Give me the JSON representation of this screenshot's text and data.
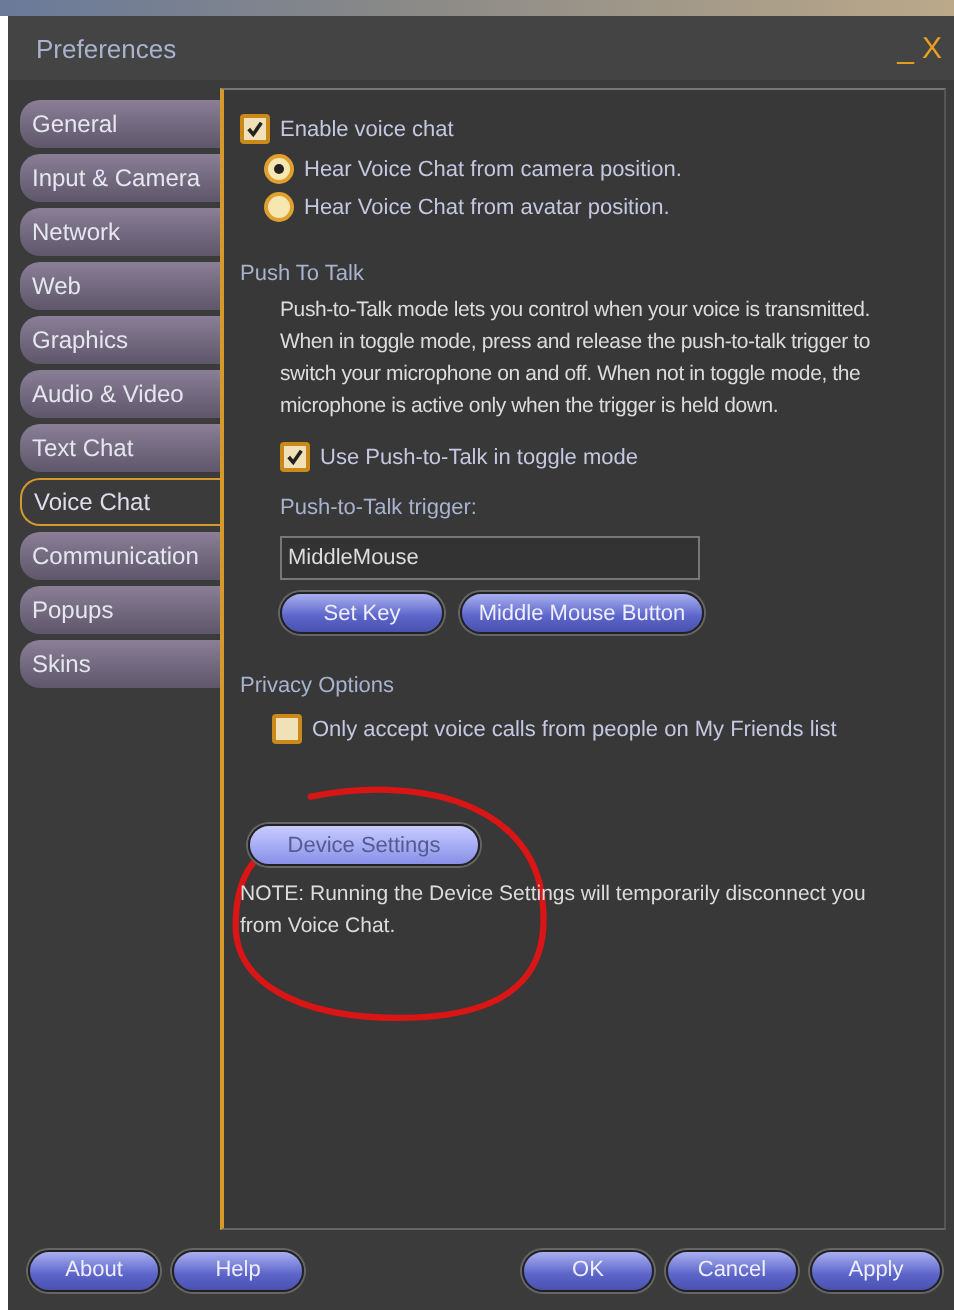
{
  "window": {
    "title": "Preferences",
    "minimize": "_",
    "close": "X"
  },
  "tabs": [
    {
      "label": "General",
      "selected": false
    },
    {
      "label": "Input & Camera",
      "selected": false
    },
    {
      "label": "Network",
      "selected": false
    },
    {
      "label": "Web",
      "selected": false
    },
    {
      "label": "Graphics",
      "selected": false
    },
    {
      "label": "Audio & Video",
      "selected": false
    },
    {
      "label": "Text Chat",
      "selected": false
    },
    {
      "label": "Voice Chat",
      "selected": true
    },
    {
      "label": "Communication",
      "selected": false
    },
    {
      "label": "Popups",
      "selected": false
    },
    {
      "label": "Skins",
      "selected": false
    }
  ],
  "enable_voice": {
    "label": "Enable voice chat",
    "checked": true
  },
  "hear_from": [
    {
      "label": "Hear Voice Chat from camera position.",
      "selected": true
    },
    {
      "label": "Hear Voice Chat from avatar position.",
      "selected": false
    }
  ],
  "push_to_talk": {
    "heading": "Push To Talk",
    "description": "Push-to-Talk mode lets you control when your voice is transmitted. When in toggle mode, press and release the push-to-talk trigger to switch your microphone on and off. When not in toggle mode, the microphone is active only when the trigger is held down.",
    "toggle": {
      "label": "Use Push-to-Talk in toggle mode",
      "checked": true
    },
    "trigger_label": "Push-to-Talk trigger:",
    "trigger_value": "MiddleMouse",
    "buttons": [
      "Set Key",
      "Middle Mouse Button"
    ]
  },
  "privacy": {
    "heading": "Privacy Options",
    "friends_only": {
      "label": "Only accept voice calls from people on My Friends list",
      "checked": false
    }
  },
  "device_settings": {
    "button": "Device Settings",
    "note": "NOTE: Running the Device Settings will temporarily disconnect you from Voice Chat."
  },
  "footer_left": [
    "About",
    "Help"
  ],
  "footer_right": [
    "OK",
    "Cancel",
    "Apply"
  ]
}
